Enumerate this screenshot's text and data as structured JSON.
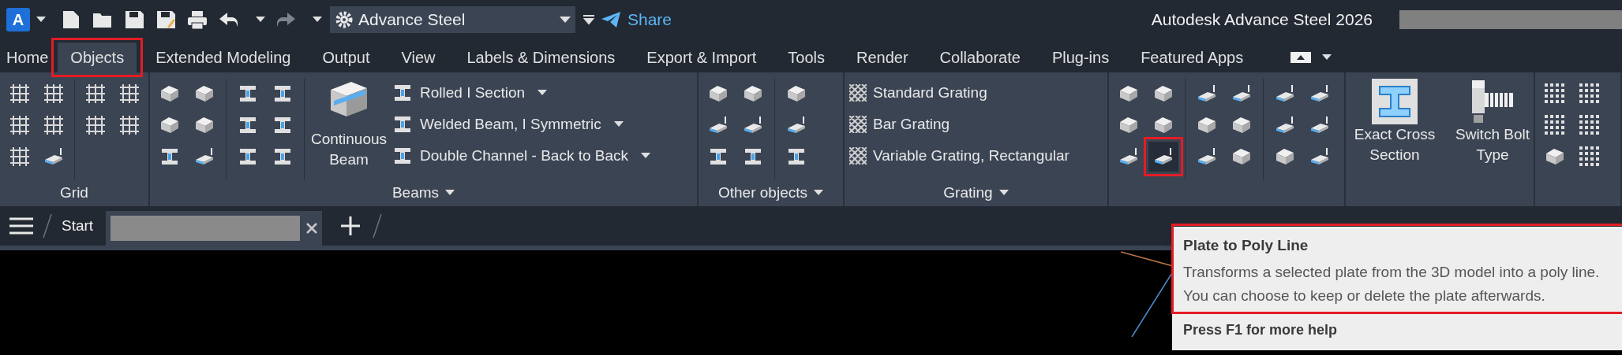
{
  "app": {
    "logo": "A"
  },
  "workspace": {
    "value": "Advance Steel"
  },
  "share": {
    "label": "Share"
  },
  "window_title": "Autodesk Advance Steel 2026",
  "ribbon_tabs": [
    {
      "label": "Home",
      "selected": false,
      "highlighted": false
    },
    {
      "label": "Objects",
      "selected": true,
      "highlighted": true
    },
    {
      "label": "Extended Modeling",
      "selected": false,
      "highlighted": false
    },
    {
      "label": "Output",
      "selected": false,
      "highlighted": false
    },
    {
      "label": "View",
      "selected": false,
      "highlighted": false
    },
    {
      "label": "Labels & Dimensions",
      "selected": false,
      "highlighted": false
    },
    {
      "label": "Export & Import",
      "selected": false,
      "highlighted": false
    },
    {
      "label": "Tools",
      "selected": false,
      "highlighted": false
    },
    {
      "label": "Render",
      "selected": false,
      "highlighted": false
    },
    {
      "label": "Collaborate",
      "selected": false,
      "highlighted": false
    },
    {
      "label": "Plug-ins",
      "selected": false,
      "highlighted": false
    },
    {
      "label": "Featured Apps",
      "selected": false,
      "highlighted": false
    }
  ],
  "grid_panel": {
    "title": "Grid"
  },
  "beams_panel": {
    "title": "Beams",
    "large_button": "Continuous Beam",
    "list": [
      {
        "label": "Rolled I Section"
      },
      {
        "label": "Welded Beam, I Symmetric"
      },
      {
        "label": "Double Channel - Back to Back"
      }
    ]
  },
  "other_objects_panel": {
    "title": "Other objects"
  },
  "grating_panel": {
    "title": "Grating",
    "list": [
      {
        "label": "Standard Grating"
      },
      {
        "label": "Bar Grating"
      },
      {
        "label": "Variable Grating, Rectangular"
      }
    ]
  },
  "plates_panel": {
    "tools": [
      {
        "highlighted": false
      },
      {
        "highlighted": false
      },
      {
        "highlighted": false
      },
      {
        "highlighted": false
      },
      {
        "highlighted": false
      },
      {
        "highlighted": true
      }
    ]
  },
  "switch_panel": {
    "buttons": [
      {
        "label": "Exact Cross Section"
      },
      {
        "label": "Switch Bolt Type"
      }
    ]
  },
  "file_tabs": [
    {
      "label": "Start"
    }
  ],
  "tooltip": {
    "title": "Plate to Poly Line",
    "description": "Transforms a selected plate from the 3D model into a poly line. You can choose to keep or delete the plate afterwards.",
    "help": "Press F1 for more help",
    "highlighted": true
  }
}
